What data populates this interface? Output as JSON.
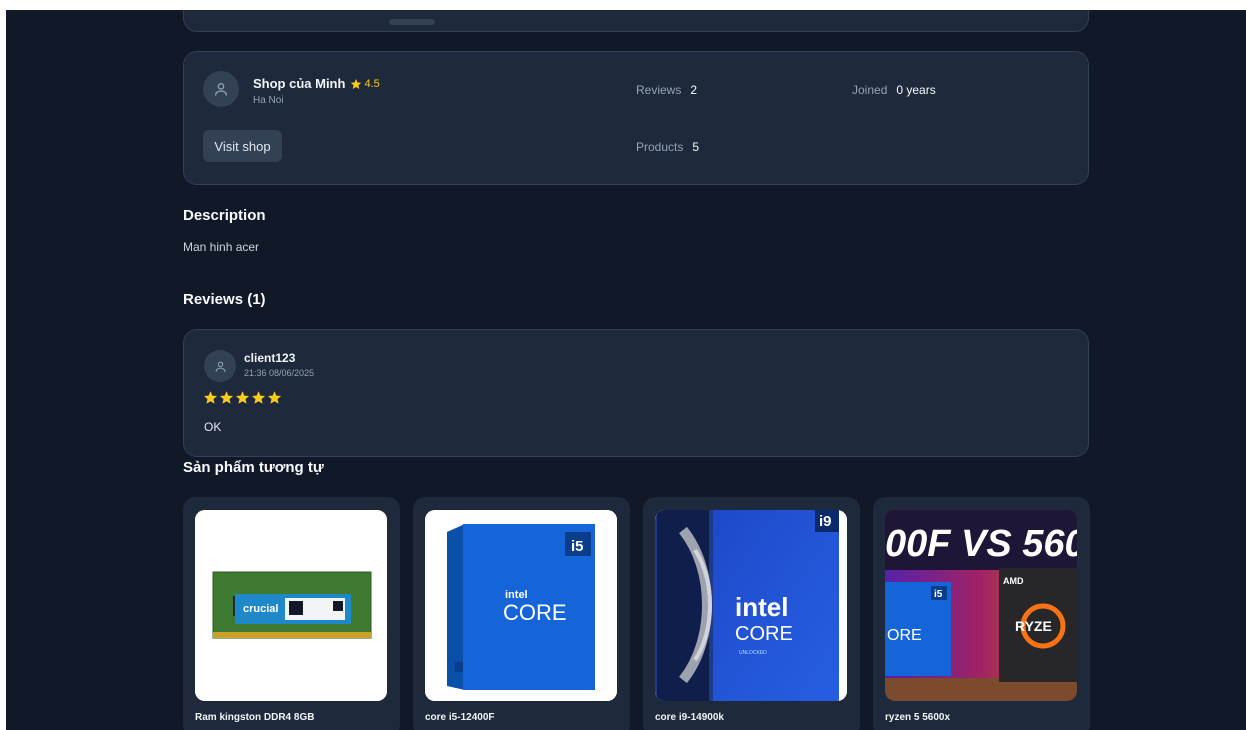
{
  "shop": {
    "name": "Shop của Minh",
    "rating": "4.5",
    "location": "Ha Noi",
    "visit_label": "Visit shop",
    "stats": {
      "reviews_label": "Reviews",
      "reviews_value": "2",
      "joined_label": "Joined",
      "joined_value": "0 years",
      "products_label": "Products",
      "products_value": "5"
    }
  },
  "description": {
    "title": "Description",
    "text": "Man hinh acer"
  },
  "reviews": {
    "title": "Reviews (1)",
    "items": [
      {
        "user": "client123",
        "time": "21:36 08/06/2025",
        "stars": 5,
        "text": "OK"
      }
    ]
  },
  "similar": {
    "title": "Sản phẩm tương tự",
    "products": [
      {
        "name": "Ram kingston DDR4 8GB",
        "image": "ram-stick-image"
      },
      {
        "name": "core i5-12400F",
        "image": "intel-core-i5-box-image",
        "badge": "i5",
        "brand": "intel",
        "line": "CORE"
      },
      {
        "name": "core i9-14900k",
        "image": "intel-core-i9-box-image",
        "badge": "i9",
        "brand": "intel",
        "line": "CORE",
        "sub": "UNLOCKED"
      },
      {
        "name": "ryzen 5 5600x",
        "image": "cpu-comparison-thumbnail",
        "headline": "00F VS 560",
        "amd": "AMD",
        "ryzen": "RYZE"
      }
    ]
  },
  "colors": {
    "background": "#111827",
    "card": "#1e293b",
    "star": "#facc15"
  }
}
